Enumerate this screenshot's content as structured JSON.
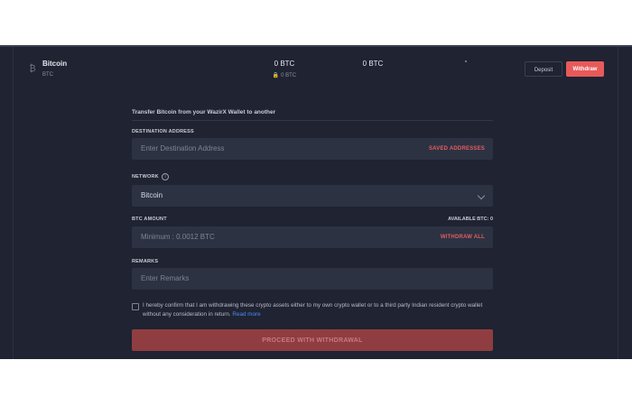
{
  "coin": {
    "name": "Bitcoin",
    "symbol": "BTC",
    "icon": "bitcoin-icon",
    "balance": "0 BTC",
    "locked_balance": "0 BTC",
    "secondary_balance": "0 BTC"
  },
  "actions": {
    "deposit_label": "Deposit",
    "withdraw_label": "Withdraw"
  },
  "form": {
    "title": "Transfer Bitcoin from your WazirX Wallet to another",
    "destination": {
      "label": "DESTINATION ADDRESS",
      "placeholder": "Enter Destination Address",
      "action": "SAVED ADDRESSES"
    },
    "network": {
      "label": "NETWORK",
      "selected": "Bitcoin",
      "info_icon": "info-icon"
    },
    "amount": {
      "label": "BTC AMOUNT",
      "available": "AVAILABLE BTC: 0",
      "placeholder": "Minimum : 0.0012 BTC",
      "action": "WITHDRAW ALL"
    },
    "remarks": {
      "label": "REMARKS",
      "placeholder": "Enter Remarks"
    },
    "confirm_text": "I hereby confirm that I am withdrawing these crypto assets either to my own crypto wallet or to a third party Indian resident crypto wallet without any consideration in return.",
    "read_more": "Read more",
    "submit_label": "PROCEED WITH WITHDRAWAL"
  },
  "colors": {
    "background": "#1f2332",
    "field": "#2d3243",
    "accent": "#e85a5a",
    "link": "#4d8bf5",
    "disabled_button": "#8f3d40"
  }
}
